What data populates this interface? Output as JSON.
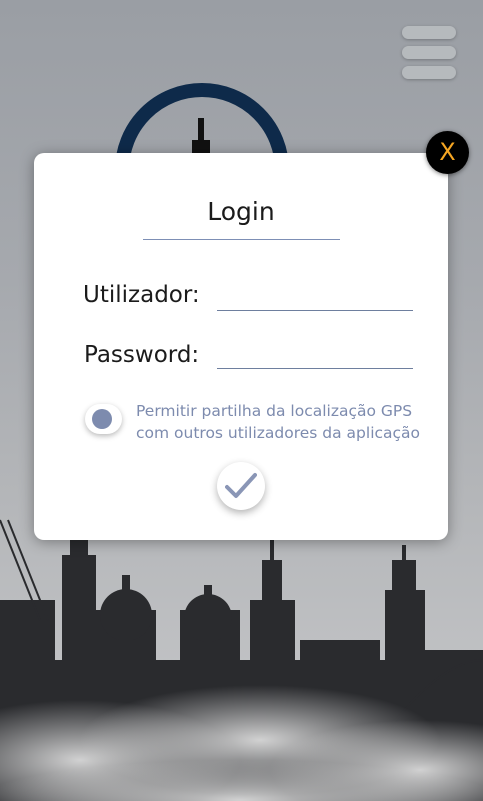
{
  "dialog": {
    "title": "Login",
    "username_label": "Utilizador:",
    "password_label": "Password:",
    "username_value": "",
    "password_value": "",
    "gps_line1": "Permitir partilha da localização GPS",
    "gps_line2": "com outros utilizadores da aplicação",
    "close_label": "X"
  },
  "icons": {
    "menu": "hamburger-menu-icon",
    "confirm": "checkmark-icon",
    "close": "close-icon"
  },
  "colors": {
    "accent": "#7d8bae",
    "close_text": "#f5a623",
    "logo_ring": "#0e2a4a"
  }
}
